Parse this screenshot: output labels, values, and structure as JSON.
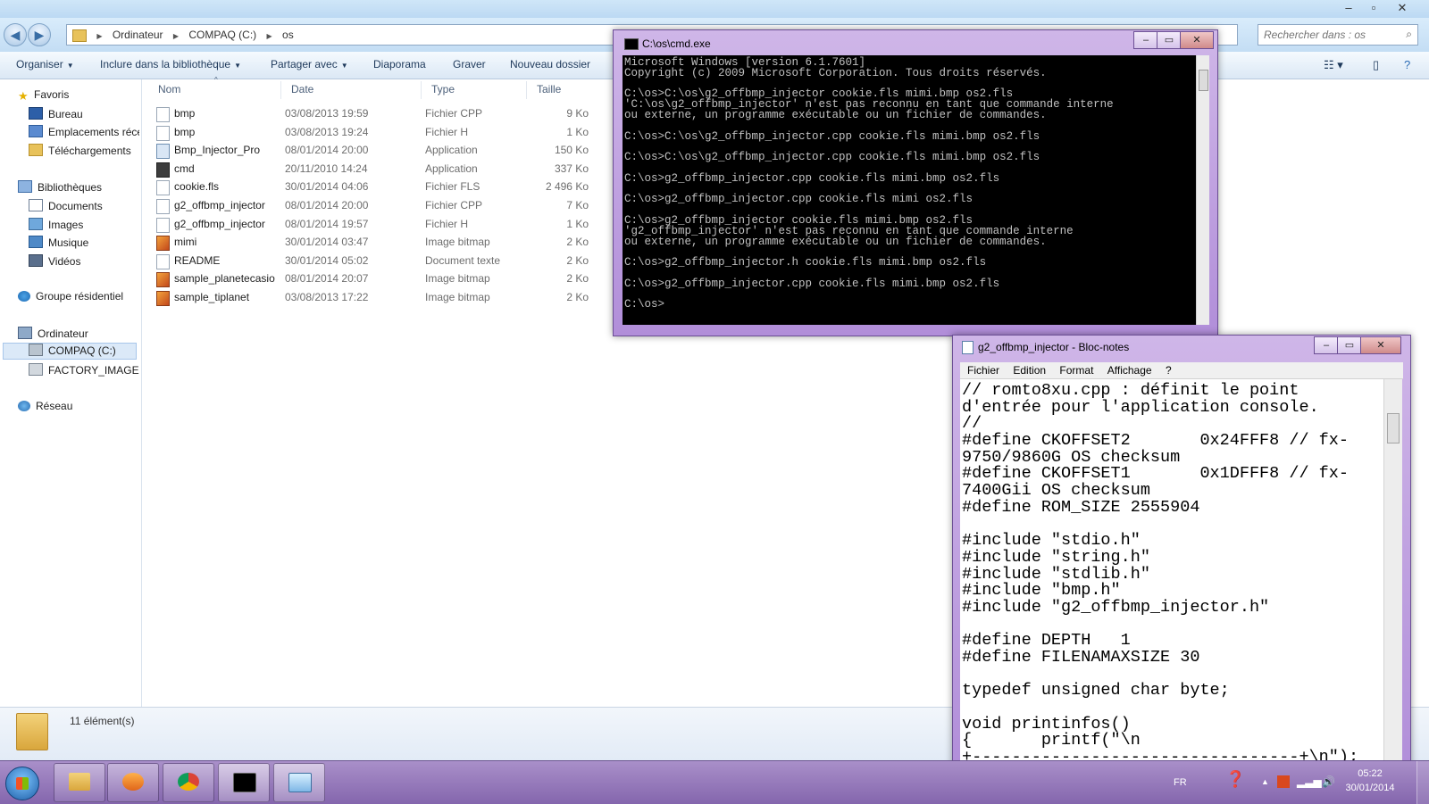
{
  "explorer": {
    "breadcrumb": [
      "Ordinateur",
      "COMPAQ (C:)",
      "os"
    ],
    "search_placeholder": "Rechercher dans : os",
    "toolbar": [
      "Organiser",
      "Inclure dans la bibliothèque",
      "Partager avec",
      "Diaporama",
      "Graver",
      "Nouveau dossier"
    ],
    "sidebar": {
      "favorites": "Favoris",
      "fav_items": [
        "Bureau",
        "Emplacements récer",
        "Téléchargements"
      ],
      "libraries": "Bibliothèques",
      "lib_items": [
        "Documents",
        "Images",
        "Musique",
        "Vidéos"
      ],
      "homegroup": "Groupe résidentiel",
      "computer": "Ordinateur",
      "drives": [
        "COMPAQ (C:)",
        "FACTORY_IMAGE (D"
      ],
      "network": "Réseau"
    },
    "columns": [
      "Nom",
      "Date",
      "Type",
      "Taille"
    ],
    "files": [
      {
        "name": "bmp",
        "date": "03/08/2013 19:59",
        "type": "Fichier CPP",
        "size": "9 Ko",
        "icon": "file-icon"
      },
      {
        "name": "bmp",
        "date": "03/08/2013 19:24",
        "type": "Fichier H",
        "size": "1 Ko",
        "icon": "file-icon"
      },
      {
        "name": "Bmp_Injector_Pro",
        "date": "08/01/2014 20:00",
        "type": "Application",
        "size": "150 Ko",
        "icon": "exe-icon"
      },
      {
        "name": "cmd",
        "date": "20/11/2010 14:24",
        "type": "Application",
        "size": "337 Ko",
        "icon": "console-icon"
      },
      {
        "name": "cookie.fls",
        "date": "30/01/2014 04:06",
        "type": "Fichier FLS",
        "size": "2 496 Ko",
        "icon": "file-icon"
      },
      {
        "name": "g2_offbmp_injector",
        "date": "08/01/2014 20:00",
        "type": "Fichier CPP",
        "size": "7 Ko",
        "icon": "file-icon"
      },
      {
        "name": "g2_offbmp_injector",
        "date": "08/01/2014 19:57",
        "type": "Fichier H",
        "size": "1 Ko",
        "icon": "file-icon"
      },
      {
        "name": "mimi",
        "date": "30/01/2014 03:47",
        "type": "Image bitmap",
        "size": "2 Ko",
        "icon": "bitmap-icon"
      },
      {
        "name": "README",
        "date": "30/01/2014 05:02",
        "type": "Document texte",
        "size": "2 Ko",
        "icon": "file-icon"
      },
      {
        "name": "sample_planetecasio",
        "date": "08/01/2014 20:07",
        "type": "Image bitmap",
        "size": "2 Ko",
        "icon": "bitmap-icon"
      },
      {
        "name": "sample_tiplanet",
        "date": "03/08/2013 17:22",
        "type": "Image bitmap",
        "size": "2 Ko",
        "icon": "bitmap-icon"
      }
    ],
    "item_count": "11 élément(s)"
  },
  "cmd": {
    "title": "C:\\os\\cmd.exe",
    "lines": [
      "Microsoft Windows [version 6.1.7601]",
      "Copyright (c) 2009 Microsoft Corporation. Tous droits réservés.",
      "",
      "C:\\os>C:\\os\\g2_offbmp_injector cookie.fls mimi.bmp os2.fls",
      "'C:\\os\\g2_offbmp_injector' n'est pas reconnu en tant que commande interne",
      "ou externe, un programme exécutable ou un fichier de commandes.",
      "",
      "C:\\os>C:\\os\\g2_offbmp_injector.cpp cookie.fls mimi.bmp os2.fls",
      "",
      "C:\\os>C:\\os\\g2_offbmp_injector.cpp cookie.fls mimi.bmp os2.fls",
      "",
      "C:\\os>g2_offbmp_injector.cpp cookie.fls mimi.bmp os2.fls",
      "",
      "C:\\os>g2_offbmp_injector.cpp cookie.fls mimi os2.fls",
      "",
      "C:\\os>g2_offbmp_injector cookie.fls mimi.bmp os2.fls",
      "'g2_offbmp_injector' n'est pas reconnu en tant que commande interne",
      "ou externe, un programme exécutable ou un fichier de commandes.",
      "",
      "C:\\os>g2_offbmp_injector.h cookie.fls mimi.bmp os2.fls",
      "",
      "C:\\os>g2_offbmp_injector.cpp cookie.fls mimi.bmp os2.fls",
      "",
      "C:\\os>"
    ]
  },
  "notepad": {
    "title": "g2_offbmp_injector - Bloc-notes",
    "menu": [
      "Fichier",
      "Edition",
      "Format",
      "Affichage",
      "?"
    ],
    "lines": [
      "// romto8xu.cpp : définit le point",
      "d'entrée pour l'application console.",
      "//",
      "#define CKOFFSET2       0x24FFF8 // fx-",
      "9750/9860G OS checksum",
      "#define CKOFFSET1       0x1DFFF8 // fx-",
      "7400Gii OS checksum",
      "#define ROM_SIZE 2555904",
      "",
      "#include \"stdio.h\"",
      "#include \"string.h\"",
      "#include \"stdlib.h\"",
      "#include \"bmp.h\"",
      "#include \"g2_offbmp_injector.h\"",
      "",
      "#define DEPTH   1",
      "#define FILENAMAXSIZE 30",
      "",
      "typedef unsigned char byte;",
      "",
      "void printinfos()",
      "{       printf(\"\\n",
      "+---------------------------------+\\n\");"
    ]
  },
  "taskbar": {
    "language": "FR",
    "time": "05:22",
    "date": "30/01/2014"
  },
  "colors": {
    "window_frame": "#b18ed9",
    "taskbar": "#8466ad",
    "console_bg": "#000000",
    "console_fg": "#c0c0c0"
  }
}
